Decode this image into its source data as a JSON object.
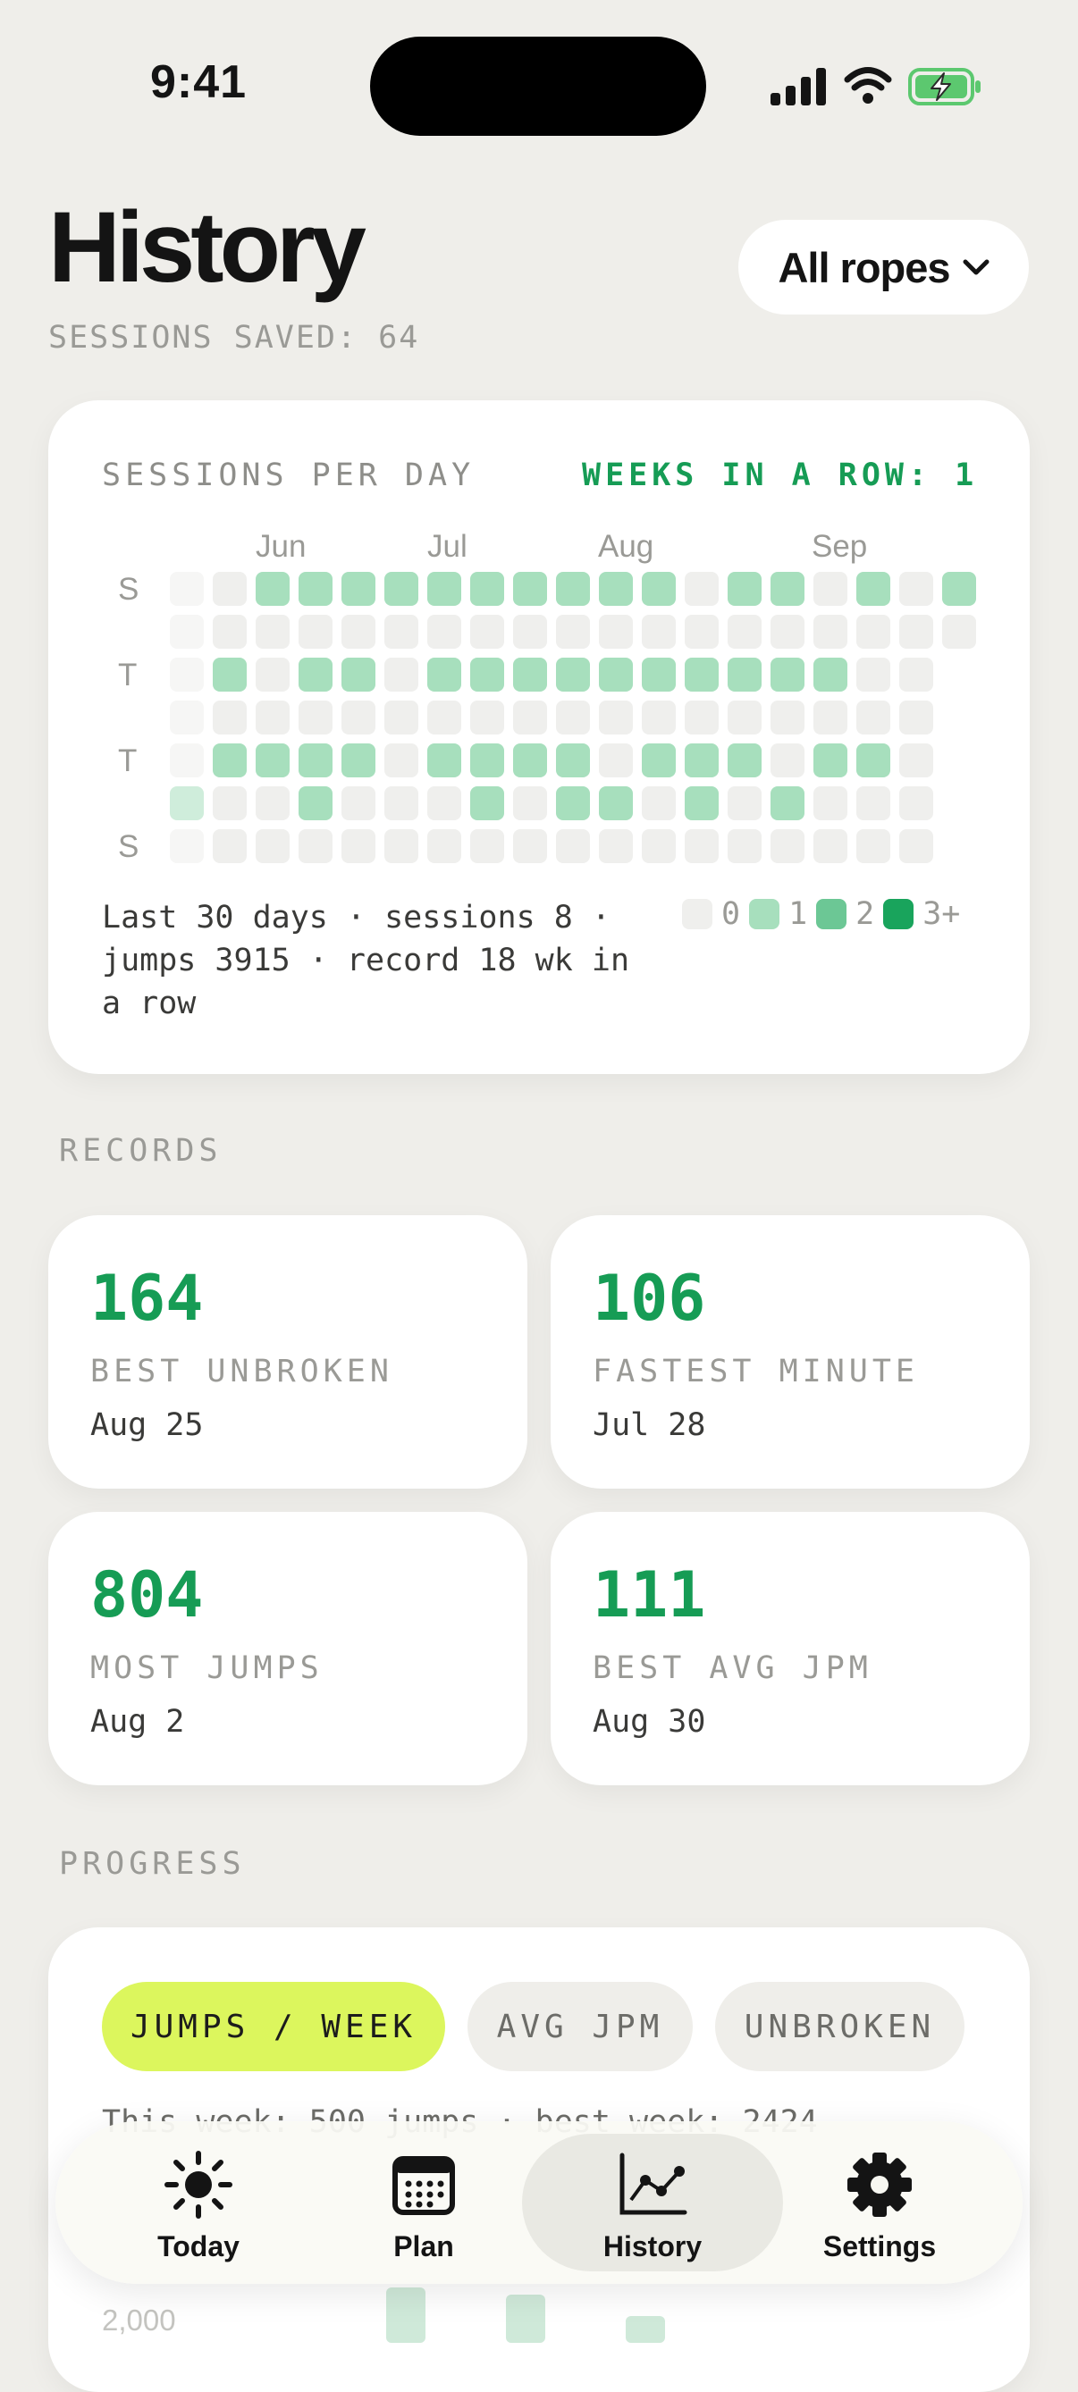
{
  "status": {
    "time": "9:41"
  },
  "header": {
    "title": "History",
    "sessions_saved": "SESSIONS SAVED: 64",
    "rope_filter": "All ropes"
  },
  "heatmap": {
    "title": "SESSIONS PER DAY",
    "streak": "WEEKS IN A ROW: 1",
    "months": [
      "Jun",
      "Jul",
      "Aug",
      "Sep"
    ],
    "day_labels": [
      "S",
      "T",
      "T",
      "S"
    ],
    "summary": "Last 30 days · sessions 8 · jumps 3915 · record 18 wk in a row",
    "legend": [
      "0",
      "1",
      "2",
      "3+"
    ],
    "colors": {
      "0": "#efefed",
      "1": "#a7dfbd",
      "2": "#6cc795",
      "3": "#19a45c"
    },
    "grid": [
      [
        0,
        0,
        1,
        1,
        1,
        1,
        1,
        1,
        1,
        1,
        1,
        1,
        0,
        1,
        1,
        0,
        1,
        0,
        1
      ],
      [
        0,
        0,
        0,
        0,
        0,
        0,
        0,
        0,
        0,
        0,
        0,
        0,
        0,
        0,
        0,
        0,
        0,
        0,
        0
      ],
      [
        0,
        1,
        0,
        1,
        1,
        0,
        1,
        1,
        1,
        1,
        1,
        1,
        1,
        1,
        1,
        1,
        0,
        0
      ],
      [
        0,
        0,
        0,
        0,
        0,
        0,
        0,
        0,
        0,
        0,
        0,
        0,
        0,
        0,
        0,
        0,
        0,
        0
      ],
      [
        0,
        1,
        1,
        1,
        1,
        0,
        1,
        1,
        1,
        1,
        0,
        1,
        1,
        1,
        0,
        1,
        1,
        0
      ],
      [
        1,
        0,
        0,
        1,
        0,
        0,
        0,
        1,
        0,
        1,
        1,
        0,
        1,
        0,
        1,
        0,
        0,
        0
      ],
      [
        0,
        0,
        0,
        0,
        0,
        0,
        0,
        0,
        0,
        0,
        0,
        0,
        0,
        0,
        0,
        0,
        0,
        0
      ]
    ]
  },
  "records": {
    "label": "RECORDS",
    "items": [
      {
        "value": "164",
        "label": "BEST UNBROKEN",
        "date": "Aug 25"
      },
      {
        "value": "106",
        "label": "FASTEST MINUTE",
        "date": "Jul 28"
      },
      {
        "value": "804",
        "label": "MOST JUMPS",
        "date": "Aug 2"
      },
      {
        "value": "111",
        "label": "BEST AVG JPM",
        "date": "Aug 30"
      }
    ]
  },
  "progress": {
    "label": "PROGRESS",
    "tabs": [
      "JUMPS / WEEK",
      "AVG JPM",
      "UNBROKEN"
    ],
    "summary": "This week: 500 jumps · best week: 2424",
    "y_tick": "2,000"
  },
  "tabbar": {
    "items": [
      "Today",
      "Plan",
      "History",
      "Settings"
    ],
    "active": "History"
  },
  "colors": {
    "accent": "#169c55",
    "pill_active": "#dcf65d",
    "background": "#efeeea"
  }
}
